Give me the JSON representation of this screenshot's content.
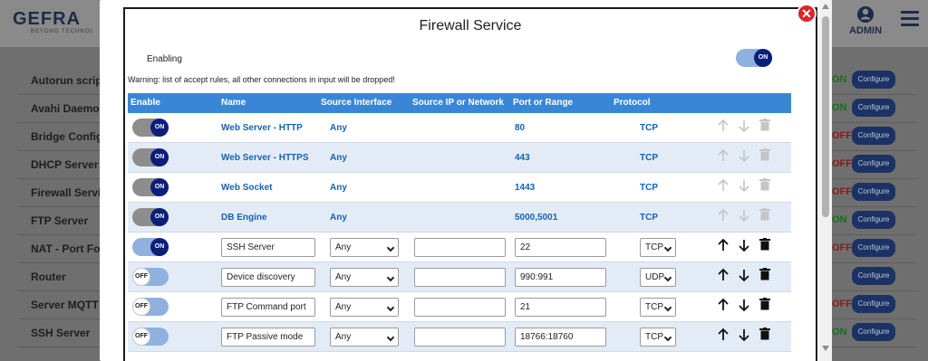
{
  "header": {
    "logo": "GEFRA",
    "logo_sub": "BEYOND TECHNOL",
    "user_label": "ADMIN",
    "user_icon": "user-icon",
    "menu_icon": "hamburger-icon"
  },
  "background_list": [
    {
      "name": "Autorun script",
      "state": "ON",
      "button": "Configure"
    },
    {
      "name": "Avahi Daemon",
      "state": "ON",
      "button": "Configure"
    },
    {
      "name": "Bridge Configu",
      "state": "OFF",
      "button": "Configure"
    },
    {
      "name": "DHCP Server",
      "state": "OFF",
      "button": "Configure"
    },
    {
      "name": "Firewall Servic",
      "state": "OFF",
      "button": "Configure"
    },
    {
      "name": "FTP Server",
      "state": "ON",
      "button": "Configure"
    },
    {
      "name": "NAT - Port For",
      "state": "OFF",
      "button": "Configure"
    },
    {
      "name": "Router",
      "state": "",
      "button": "Configure"
    },
    {
      "name": "Server MQTT",
      "state": "OFF",
      "button": "Configure"
    },
    {
      "name": "SSH Server",
      "state": "ON",
      "button": "Configure"
    }
  ],
  "modal": {
    "title": "Firewall Service",
    "enabling_label": "Enabling",
    "enabling_state": "ON",
    "warning": "Warning: list of accept rules, all other connections in input will be dropped!",
    "close_icon": "close-icon",
    "columns": [
      "Enable",
      "Name",
      "Source Interface",
      "Source IP or Network",
      "Port or Range",
      "Protocol"
    ],
    "rows": [
      {
        "enable": "ON",
        "locked": true,
        "name": "Web Server - HTTP",
        "iface": "Any",
        "ip": "",
        "port": "80",
        "protocol": "TCP"
      },
      {
        "enable": "ON",
        "locked": true,
        "name": "Web Server - HTTPS",
        "iface": "Any",
        "ip": "",
        "port": "443",
        "protocol": "TCP"
      },
      {
        "enable": "ON",
        "locked": true,
        "name": "Web Socket",
        "iface": "Any",
        "ip": "",
        "port": "1443",
        "protocol": "TCP"
      },
      {
        "enable": "ON",
        "locked": true,
        "name": "DB Engine",
        "iface": "Any",
        "ip": "",
        "port": "5000,5001",
        "protocol": "TCP"
      },
      {
        "enable": "ON",
        "locked": false,
        "name": "SSH Server",
        "iface": "Any",
        "ip": "",
        "port": "22",
        "protocol": "TCP"
      },
      {
        "enable": "OFF",
        "locked": false,
        "name": "Device discovery",
        "iface": "Any",
        "ip": "",
        "port": "990:991",
        "protocol": "UDP"
      },
      {
        "enable": "OFF",
        "locked": false,
        "name": "FTP Command port",
        "iface": "Any",
        "ip": "",
        "port": "21",
        "protocol": "TCP"
      },
      {
        "enable": "OFF",
        "locked": false,
        "name": "FTP Passive mode",
        "iface": "Any",
        "ip": "",
        "port": "18766:18760",
        "protocol": "TCP"
      }
    ]
  },
  "colors": {
    "table_header": "#3a86d6",
    "link_text": "#1463b5",
    "toggle_knob_on": "#0b1e78",
    "close_red": "#e0232a"
  }
}
